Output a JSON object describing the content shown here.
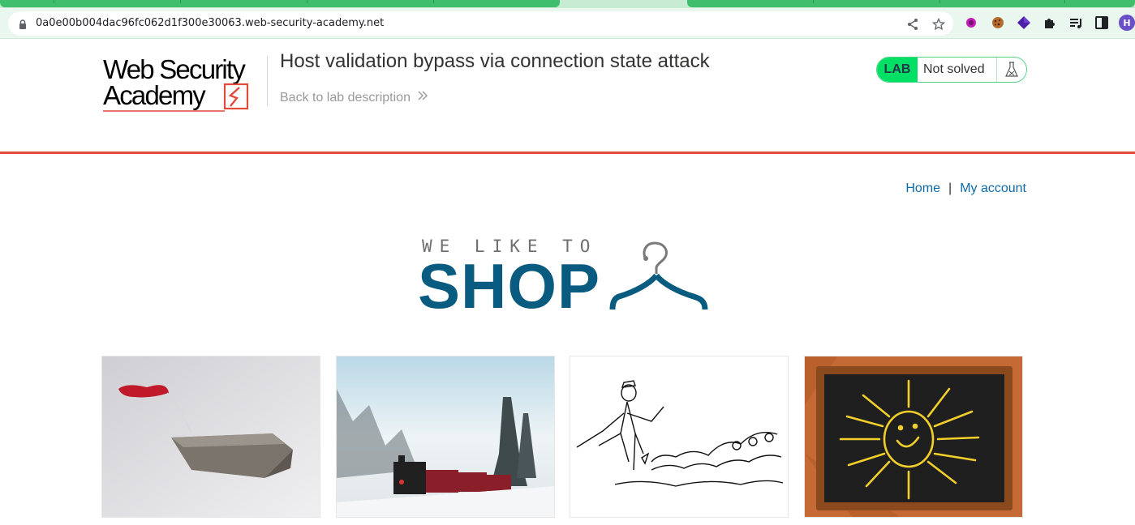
{
  "browser": {
    "url": "0a0e00b004dac96fc062d1f300e30063.web-security-academy.net",
    "profile_initial": "H",
    "icons": [
      "lock-icon",
      "share-icon",
      "star-icon",
      "ext-purple-icon",
      "cookie-icon",
      "diamond-icon",
      "puzzle-icon",
      "playlist-icon",
      "sidepanel-icon"
    ]
  },
  "header": {
    "logo_line1": "Web Security",
    "logo_line2": "Academy",
    "lab_title": "Host validation bypass via connection state attack",
    "back_link": "Back to lab description",
    "lab_badge": "LAB",
    "lab_status": "Not solved"
  },
  "nav": {
    "home": "Home",
    "separator": "|",
    "my_account": "My account"
  },
  "shop": {
    "tagline": "WE LIKE TO",
    "word": "SHOP"
  },
  "products": [
    {
      "image": "tea-bag"
    },
    {
      "image": "snowy-train"
    },
    {
      "image": "man-with-cats-sketch"
    },
    {
      "image": "chalkboard-sun"
    }
  ],
  "colors": {
    "accent_red": "#e24a3b",
    "lab_green": "#00e065",
    "link_blue": "#0d6aa8",
    "shop_blue": "#0a5b80",
    "chrome_green": "#3fbf6d"
  }
}
